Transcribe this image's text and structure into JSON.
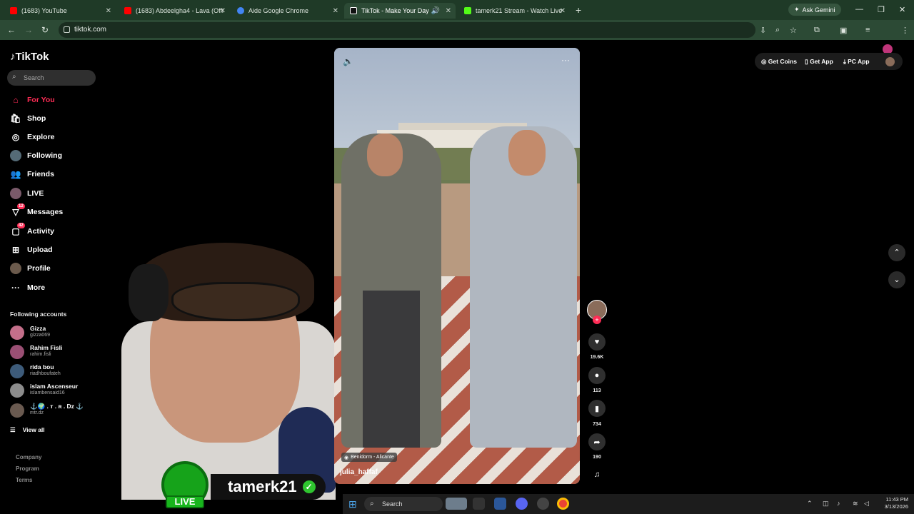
{
  "browser": {
    "tabs": [
      {
        "label": "(1683) YouTube",
        "color": "#ff0000",
        "active": false
      },
      {
        "label": "(1683) Abdeelgha4 - Lava (Offi",
        "color": "#ff0000",
        "active": false
      },
      {
        "label": "Aide Google Chrome",
        "color": "#4285f4",
        "active": false
      },
      {
        "label": "TikTok - Make Your Day",
        "color": "#000000",
        "active": true
      },
      {
        "label": "tamerk21 Stream - Watch Live",
        "color": "#53fc18",
        "active": false
      }
    ],
    "gemini_label": "Ask Gemini",
    "url": "tiktok.com"
  },
  "tiktok": {
    "brand": "TikTok",
    "search_placeholder": "Search",
    "nav": [
      {
        "label": "For You",
        "icon": "home-icon",
        "active": true
      },
      {
        "label": "Shop",
        "icon": "shop-icon"
      },
      {
        "label": "Explore",
        "icon": "compass-icon"
      },
      {
        "label": "Following",
        "icon": "following-icon"
      },
      {
        "label": "Friends",
        "icon": "friends-icon"
      },
      {
        "label": "LIVE",
        "icon": "live-icon"
      },
      {
        "label": "Messages",
        "icon": "messages-icon",
        "badge": "12"
      },
      {
        "label": "Activity",
        "icon": "activity-icon",
        "badge": "42"
      },
      {
        "label": "Upload",
        "icon": "upload-icon"
      },
      {
        "label": "Profile",
        "icon": "profile-icon"
      },
      {
        "label": "More",
        "icon": "more-icon"
      }
    ],
    "following_title": "Following accounts",
    "accounts": [
      {
        "name": "Gizza",
        "username": "gizza069"
      },
      {
        "name": "Rahim Fisli",
        "username": "rahim.fisli"
      },
      {
        "name": "rida bou",
        "username": "riadhboufateh"
      },
      {
        "name": "islam Ascenseur",
        "username": "islambensaid16"
      },
      {
        "name": "⚓🌍 . ᴛ . ʀ . Dz ⚓",
        "username": "mtr.dz"
      }
    ],
    "view_all": "View all",
    "footer": [
      "Company",
      "Program",
      "Terms"
    ],
    "top_actions": {
      "coins": "Get Coins",
      "app": "Get App",
      "pc": "PC App"
    },
    "video": {
      "location": "Benidorm - Alicante",
      "handle": "julia_haffaf",
      "likes": "19.6K",
      "comments": "113",
      "saves": "734",
      "shares": "190"
    }
  },
  "overlay": {
    "streamer": "tamerk21",
    "live_label": "LIVE"
  },
  "taskbar": {
    "search": "Search",
    "time": "11:43 PM",
    "date": "3/13/2026"
  }
}
